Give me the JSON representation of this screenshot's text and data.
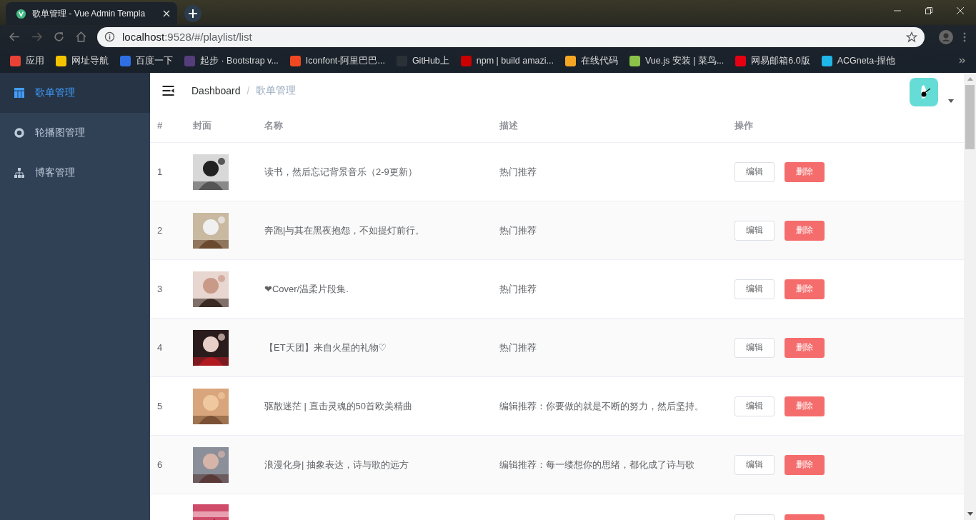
{
  "browser": {
    "tab_title": "歌单管理 - Vue Admin Templa",
    "url_host": "localhost",
    "url_rest": ":9528/#/playlist/list",
    "bookmarks": [
      {
        "label": "应用",
        "color": "#e94235"
      },
      {
        "label": "网址导航",
        "color": "#f5c400"
      },
      {
        "label": "百度一下",
        "color": "#2f6fe4"
      },
      {
        "label": "起步 · Bootstrap v...",
        "color": "#563d7c"
      },
      {
        "label": "Iconfont-阿里巴巴...",
        "color": "#f24822"
      },
      {
        "label": "GitHub上",
        "color": "#2b3137"
      },
      {
        "label": "npm | build amazi...",
        "color": "#cb0000"
      },
      {
        "label": "在线代码",
        "color": "#f5a623"
      },
      {
        "label": "Vue.js 安装 | 菜鸟...",
        "color": "#8bc34a"
      },
      {
        "label": "网易邮箱6.0版",
        "color": "#e60012"
      },
      {
        "label": "ACGneta-捏他",
        "color": "#1fb6e8"
      }
    ]
  },
  "sidebar": {
    "items": [
      {
        "label": "歌单管理",
        "selected": true
      },
      {
        "label": "轮播图管理",
        "selected": false
      },
      {
        "label": "博客管理",
        "selected": false
      }
    ]
  },
  "breadcrumb": [
    "Dashboard",
    "歌单管理"
  ],
  "breadcrumb_separator": "/",
  "table": {
    "columns": [
      "#",
      "封面",
      "名称",
      "描述",
      "操作"
    ],
    "rows": [
      {
        "index": "1",
        "name": "读书，然后忘记背景音乐（2-9更新）",
        "description": "热门推荐",
        "actions": [
          "编辑",
          "删除"
        ]
      },
      {
        "index": "2",
        "name": "奔跑|与其在黑夜抱怨，不如提灯前行。",
        "description": "热门推荐",
        "actions": [
          "编辑",
          "删除"
        ]
      },
      {
        "index": "3",
        "name": "❤Cover/温柔片段集.",
        "description": "热门推荐",
        "actions": [
          "编辑",
          "删除"
        ]
      },
      {
        "index": "4",
        "name": "【ET天团】来自火星的礼物♡",
        "description": "热门推荐",
        "actions": [
          "编辑",
          "删除"
        ]
      },
      {
        "index": "5",
        "name": "驱散迷茫 | 直击灵魂的50首欧美精曲",
        "description": "编辑推荐：你要做的就是不断的努力，然后坚持。",
        "actions": [
          "编辑",
          "删除"
        ]
      },
      {
        "index": "6",
        "name": "浪漫化身| 抽象表达，诗与歌的远方",
        "description": "编辑推荐：每一缕想你的思绪，都化成了诗与歌",
        "actions": [
          "编辑",
          "删除"
        ]
      }
    ],
    "partial_row": {
      "kind": "picture"
    }
  }
}
